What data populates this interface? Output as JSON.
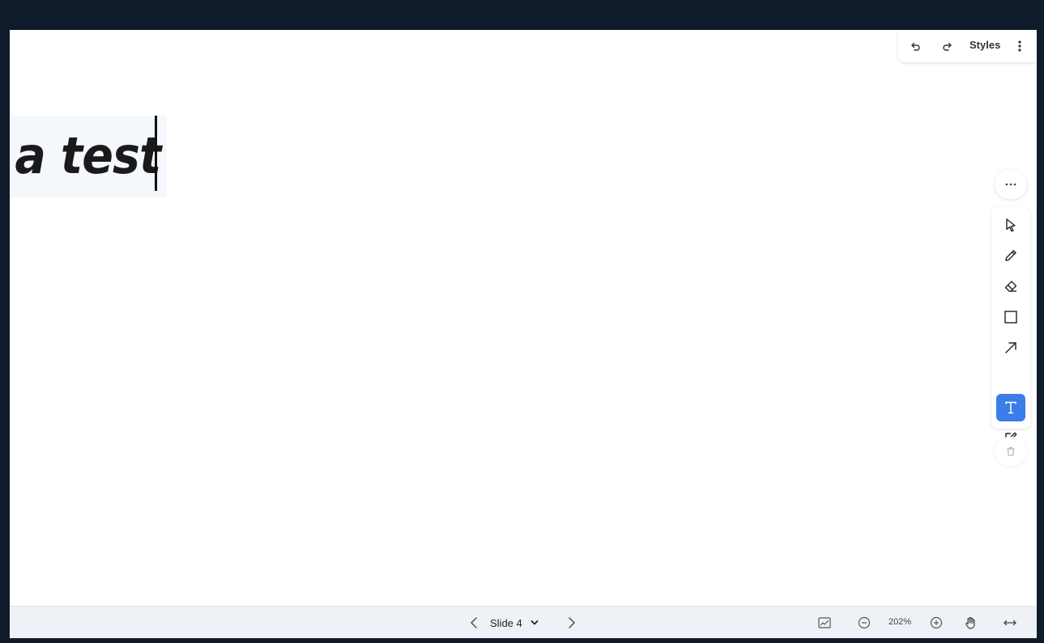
{
  "canvas": {
    "text_content": "is a test"
  },
  "top_toolbar": {
    "undo_icon": "undo-icon",
    "redo_icon": "redo-icon",
    "styles_label": "Styles",
    "menu_icon": "kebab-menu-icon"
  },
  "tool_palette": {
    "more_icon": "ellipsis-icon",
    "tools": [
      {
        "name": "select",
        "icon": "cursor-arrow-icon",
        "active": false
      },
      {
        "name": "pen",
        "icon": "pencil-icon",
        "active": false
      },
      {
        "name": "eraser",
        "icon": "eraser-icon",
        "active": false
      },
      {
        "name": "rectangle",
        "icon": "square-icon",
        "active": false
      },
      {
        "name": "arrow",
        "icon": "arrow-up-right-icon",
        "active": false
      },
      {
        "name": "text",
        "icon": "text-t-icon",
        "active": true
      },
      {
        "name": "note",
        "icon": "edit-note-icon",
        "active": false
      }
    ],
    "delete_icon": "trash-icon",
    "accent_color": "#3b7de9"
  },
  "bottom_bar": {
    "prev_icon": "chevron-left-icon",
    "slide_label": "Slide 4",
    "dropdown_icon": "chevron-down-icon",
    "next_icon": "chevron-right-icon",
    "chart_icon": "chart-icon",
    "zoom_out_icon": "zoom-out-icon",
    "zoom_level": "202%",
    "zoom_in_icon": "zoom-in-icon",
    "hand_icon": "hand-icon",
    "fit_width_icon": "fit-width-icon"
  }
}
